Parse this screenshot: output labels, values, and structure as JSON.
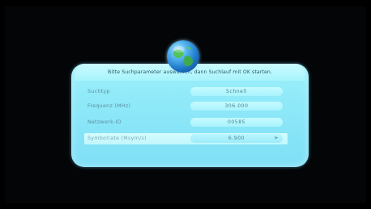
{
  "dialog": {
    "instruction": "Bitte Suchparameter auswählen, dann Suchlauf mit OK starten."
  },
  "fields": [
    {
      "label": "Suchtyp",
      "value": "Schnell"
    },
    {
      "label": "Frequenz (MHz)",
      "value": "306.000"
    },
    {
      "label": "Netzwerk-ID",
      "value": "00585"
    },
    {
      "label": "Symbolrate (Msym/s)",
      "value": "6.900"
    }
  ],
  "icons": {
    "header": "globe-icon",
    "selected_arrow": "chevron-right-icon"
  },
  "colors": {
    "panel": "#8fe9f8",
    "header": "#b8f7fd",
    "field_box": "#b6f6fe",
    "label_text": "#5c8fa0",
    "background": "#000000"
  }
}
